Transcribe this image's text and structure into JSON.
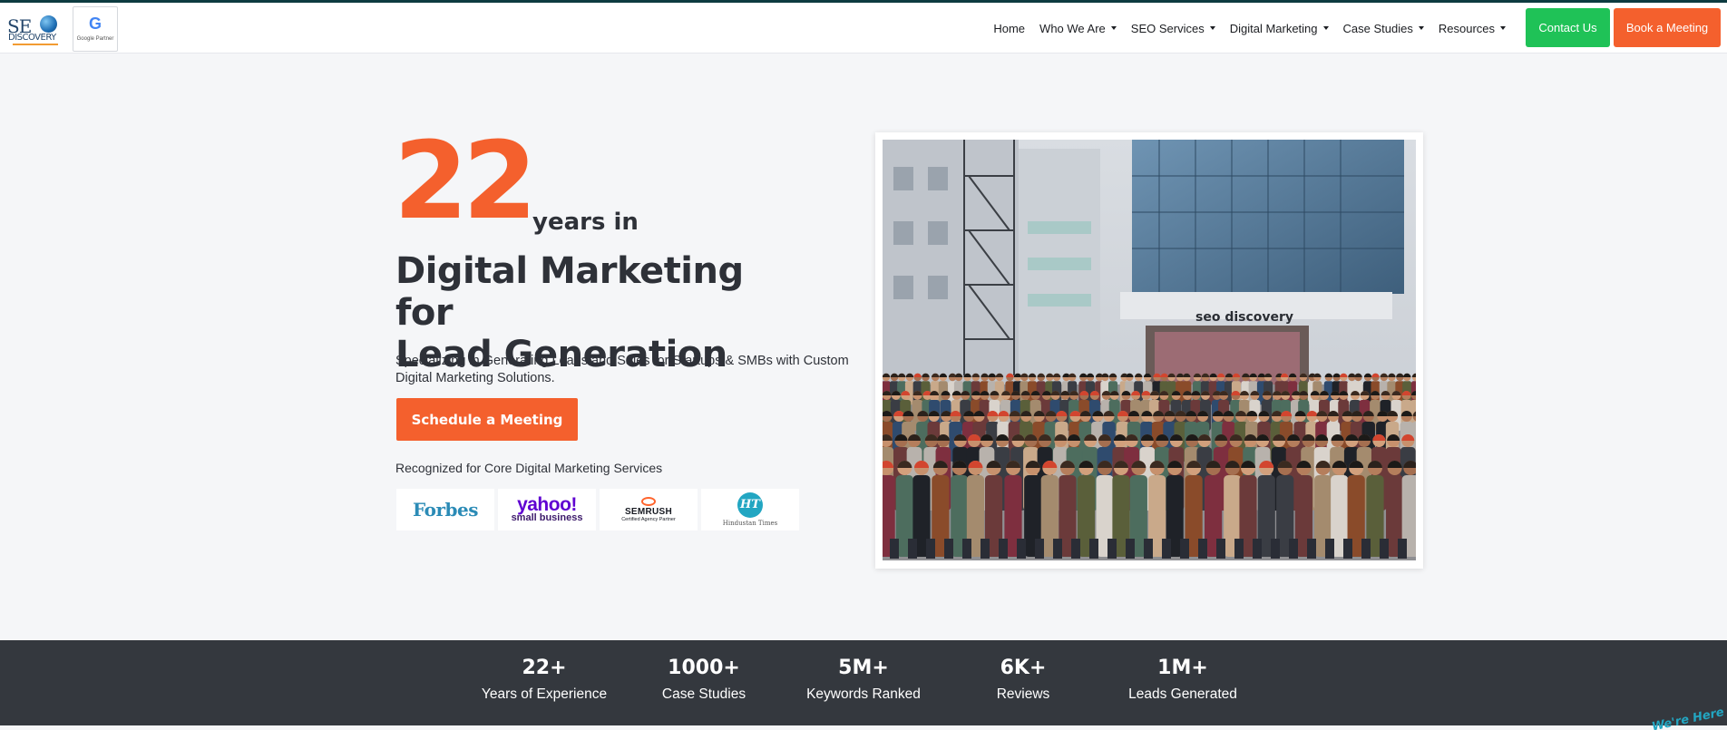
{
  "brand": {
    "logo_text": "SE",
    "logo_sub": "DISCOVERY",
    "partner_badge_logo": "G",
    "partner_badge_label": "Google Partner"
  },
  "nav": {
    "items": [
      {
        "label": "Home",
        "has_dropdown": false
      },
      {
        "label": "Who We Are",
        "has_dropdown": true
      },
      {
        "label": "SEO Services",
        "has_dropdown": true
      },
      {
        "label": "Digital Marketing",
        "has_dropdown": true
      },
      {
        "label": "Case Studies",
        "has_dropdown": true
      },
      {
        "label": "Resources",
        "has_dropdown": true
      }
    ],
    "contact_label": "Contact Us",
    "book_label": "Book a Meeting"
  },
  "hero": {
    "big_number": "22",
    "years_text": "years in",
    "headline_line1": "Digital Marketing for",
    "headline_line2": "Lead Generation",
    "subtext": "Specializing in Generating Leads and Sales for Startups & SMBs with Custom Digital Marketing Solutions.",
    "cta_label": "Schedule a Meeting",
    "recognized_text": "Recognized for Core Digital Marketing Services",
    "badges": {
      "forbes": "Forbes",
      "yahoo_top": "yahoo!",
      "yahoo_bottom": "small business",
      "semrush_top": "SEMRUSH",
      "semrush_bottom": "Certified Agency Partner",
      "ht_logo": "HT",
      "ht_name": "Hindustan Times"
    },
    "photo_sign": "seo discovery"
  },
  "stats": [
    {
      "value": "22+",
      "label": "Years of Experience"
    },
    {
      "value": "1000+",
      "label": "Case Studies"
    },
    {
      "value": "5M+",
      "label": "Keywords Ranked"
    },
    {
      "value": "6K+",
      "label": "Reviews"
    },
    {
      "value": "1M+",
      "label": "Leads Generated"
    }
  ],
  "chat_widget": "We're Here",
  "colors": {
    "accent_orange": "#f4602d",
    "contact_green": "#1fc257",
    "stats_bg": "#34383e",
    "text_dark": "#2e3138"
  }
}
